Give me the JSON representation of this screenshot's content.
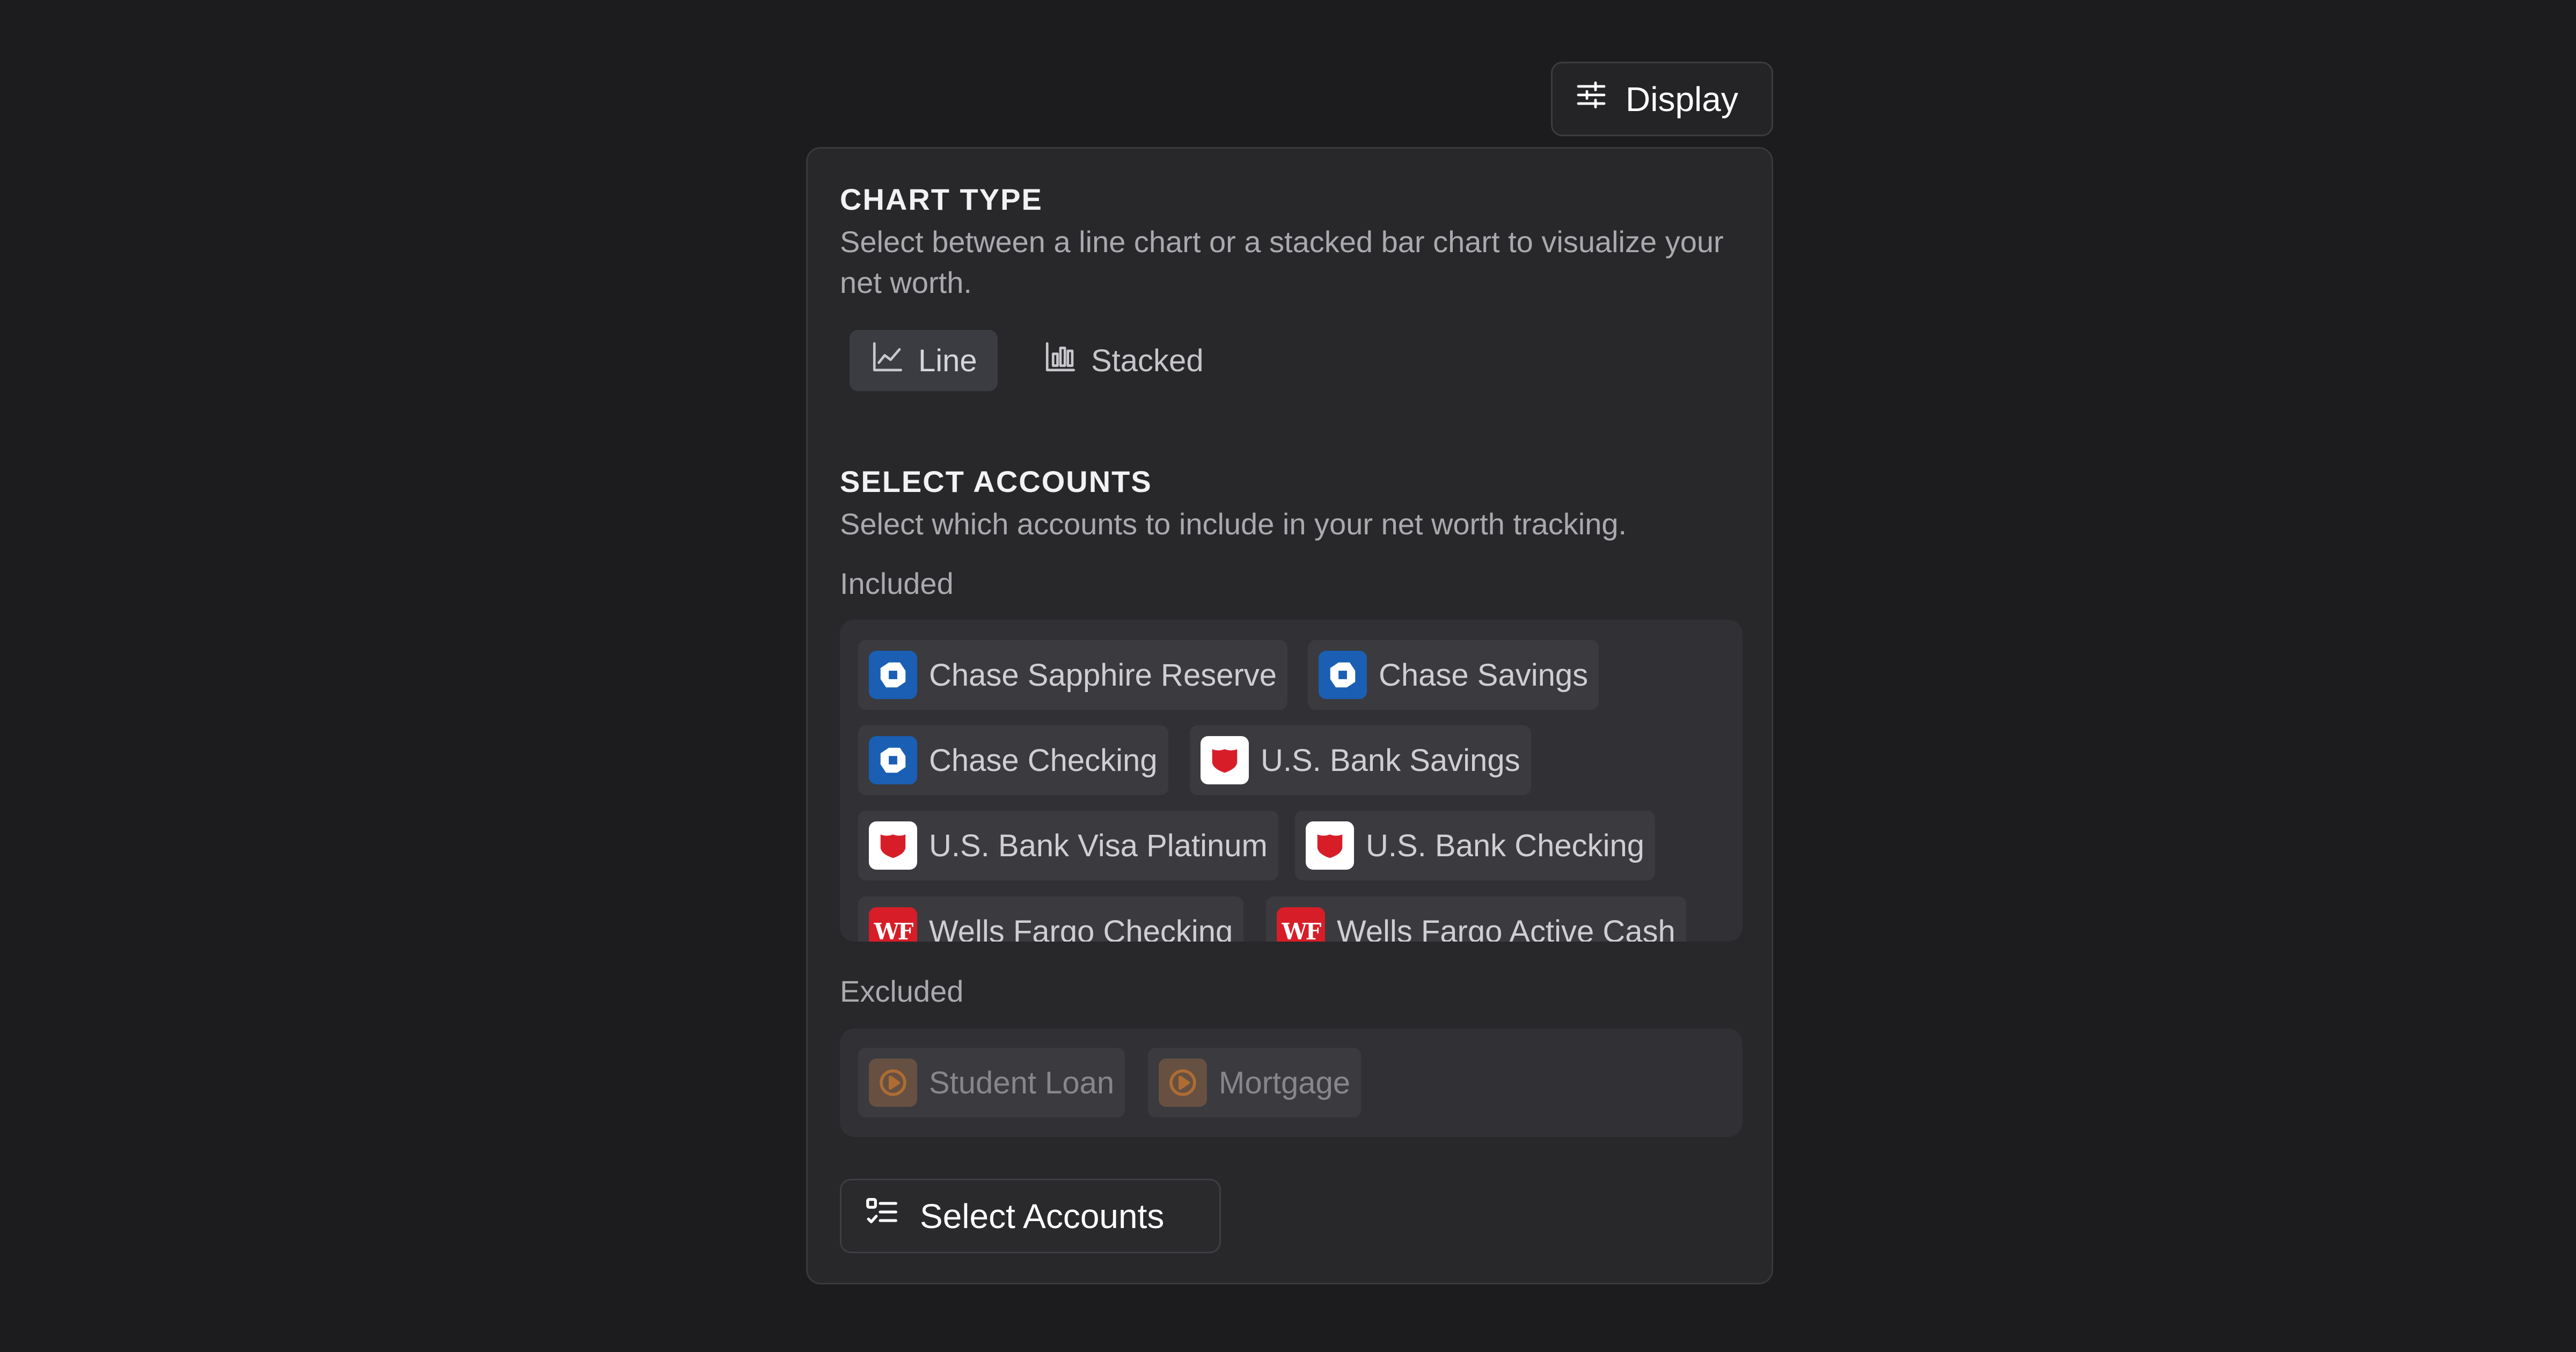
{
  "header": {
    "display_label": "Display"
  },
  "chart_type": {
    "title": "CHART TYPE",
    "description": "Select between a line chart or a stacked bar chart to visualize your net worth.",
    "options": [
      {
        "label": "Line",
        "icon": "line-chart-icon",
        "selected": true
      },
      {
        "label": "Stacked",
        "icon": "bar-chart-icon",
        "selected": false
      }
    ]
  },
  "select_accounts": {
    "title": "SELECT ACCOUNTS",
    "description": "Select which accounts to include in your net worth tracking.",
    "included_label": "Included",
    "excluded_label": "Excluded",
    "included": [
      {
        "name": "Chase Sapphire Reserve",
        "bank": "chase"
      },
      {
        "name": "Chase Savings",
        "bank": "chase"
      },
      {
        "name": "Chase Checking",
        "bank": "chase"
      },
      {
        "name": "U.S. Bank Savings",
        "bank": "usbank"
      },
      {
        "name": "U.S. Bank Visa Platinum",
        "bank": "usbank"
      },
      {
        "name": "U.S. Bank Checking",
        "bank": "usbank"
      },
      {
        "name": "Wells Fargo Checking",
        "bank": "wf",
        "logo_text": "WF"
      },
      {
        "name": "Wells Fargo Active Cash",
        "bank": "wf",
        "logo_text": "WF"
      }
    ],
    "excluded": [
      {
        "name": "Student Loan",
        "bank": "loan"
      },
      {
        "name": "Mortgage",
        "bank": "loan"
      }
    ],
    "button_label": "Select Accounts"
  },
  "colors": {
    "background": "#1c1c1e",
    "panel": "#28282b",
    "chase_blue": "#1a5fb4",
    "usbank_red": "#d71e28",
    "wf_red": "#d71e28"
  }
}
